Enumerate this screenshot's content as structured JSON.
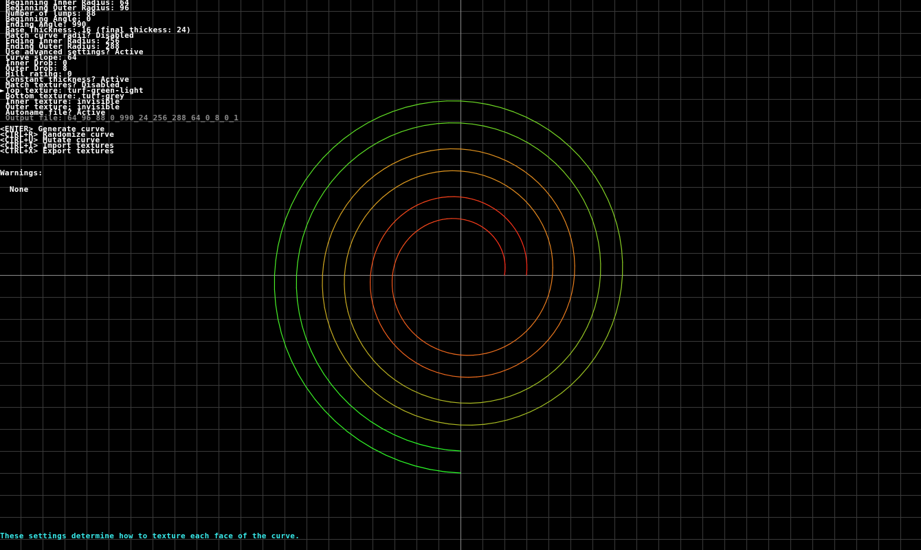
{
  "settings": [
    {
      "label": "Beginning Inner Radius: 64",
      "selected": false,
      "dim": false
    },
    {
      "label": "Beginning Outer Radius: 96",
      "selected": false,
      "dim": false
    },
    {
      "label": "Number of lumps: 88",
      "selected": false,
      "dim": false
    },
    {
      "label": "Beginning Angle: 0",
      "selected": false,
      "dim": false
    },
    {
      "label": "Ending Angle: 990",
      "selected": false,
      "dim": false
    },
    {
      "label": "Base Thickness: 16 (final thickess: 24)",
      "selected": false,
      "dim": false
    },
    {
      "label": "Match curve radii? Disabled",
      "selected": false,
      "dim": false
    },
    {
      "label": "Ending Inner Radius: 256",
      "selected": false,
      "dim": false
    },
    {
      "label": "Ending Outer Radius: 288",
      "selected": false,
      "dim": false
    },
    {
      "label": "Use advanced settings? Active",
      "selected": false,
      "dim": false
    },
    {
      "label": "Curve slope: 64",
      "selected": false,
      "dim": false
    },
    {
      "label": "Inner Drop: 0",
      "selected": false,
      "dim": false
    },
    {
      "label": "Outer Drop: 8",
      "selected": false,
      "dim": false
    },
    {
      "label": "Hill rating: 0",
      "selected": false,
      "dim": false
    },
    {
      "label": "Constant thickness? Active",
      "selected": false,
      "dim": false
    },
    {
      "label": "Match textures? Disabled",
      "selected": false,
      "dim": false
    },
    {
      "label": "Top texture: turf-green-light",
      "selected": true,
      "dim": false
    },
    {
      "label": "Bottom texture: turf-grey",
      "selected": false,
      "dim": false
    },
    {
      "label": "Inner texture: invisible",
      "selected": false,
      "dim": false
    },
    {
      "label": "Outer texture: invisible",
      "selected": false,
      "dim": false
    },
    {
      "label": "Autoname file? Active",
      "selected": false,
      "dim": false
    },
    {
      "label": "Output file: 64_96_88_0_990_24_256_288_64_0_8_0_1",
      "selected": false,
      "dim": true
    }
  ],
  "cursor_glyph": "►",
  "actions": [
    "<ENTER> Generate curve",
    "<CTRL+R> Randomize curve",
    "<CTRL+U> Mutate curve",
    "<CTRL+I> Import textures",
    "<CTRL+X> Export textures"
  ],
  "warnings": {
    "title": "Warnings:",
    "value": "  None"
  },
  "status_text": "These settings determine how to texture each face of the curve.",
  "colors": {
    "background": "#000000",
    "grid": "#3a3a3a",
    "axis": "#8c8c8c",
    "text": "#ffffff",
    "dim_text": "#8a8a8a",
    "status": "#38e8e8",
    "curve_start": "#ff2a1a",
    "curve_mid": "#e0a020",
    "curve_end": "#28ff28"
  },
  "curve": {
    "inner_start": 64,
    "outer_start": 96,
    "inner_end": 256,
    "outer_end": 288,
    "angle_start": 0,
    "angle_end": 990
  }
}
